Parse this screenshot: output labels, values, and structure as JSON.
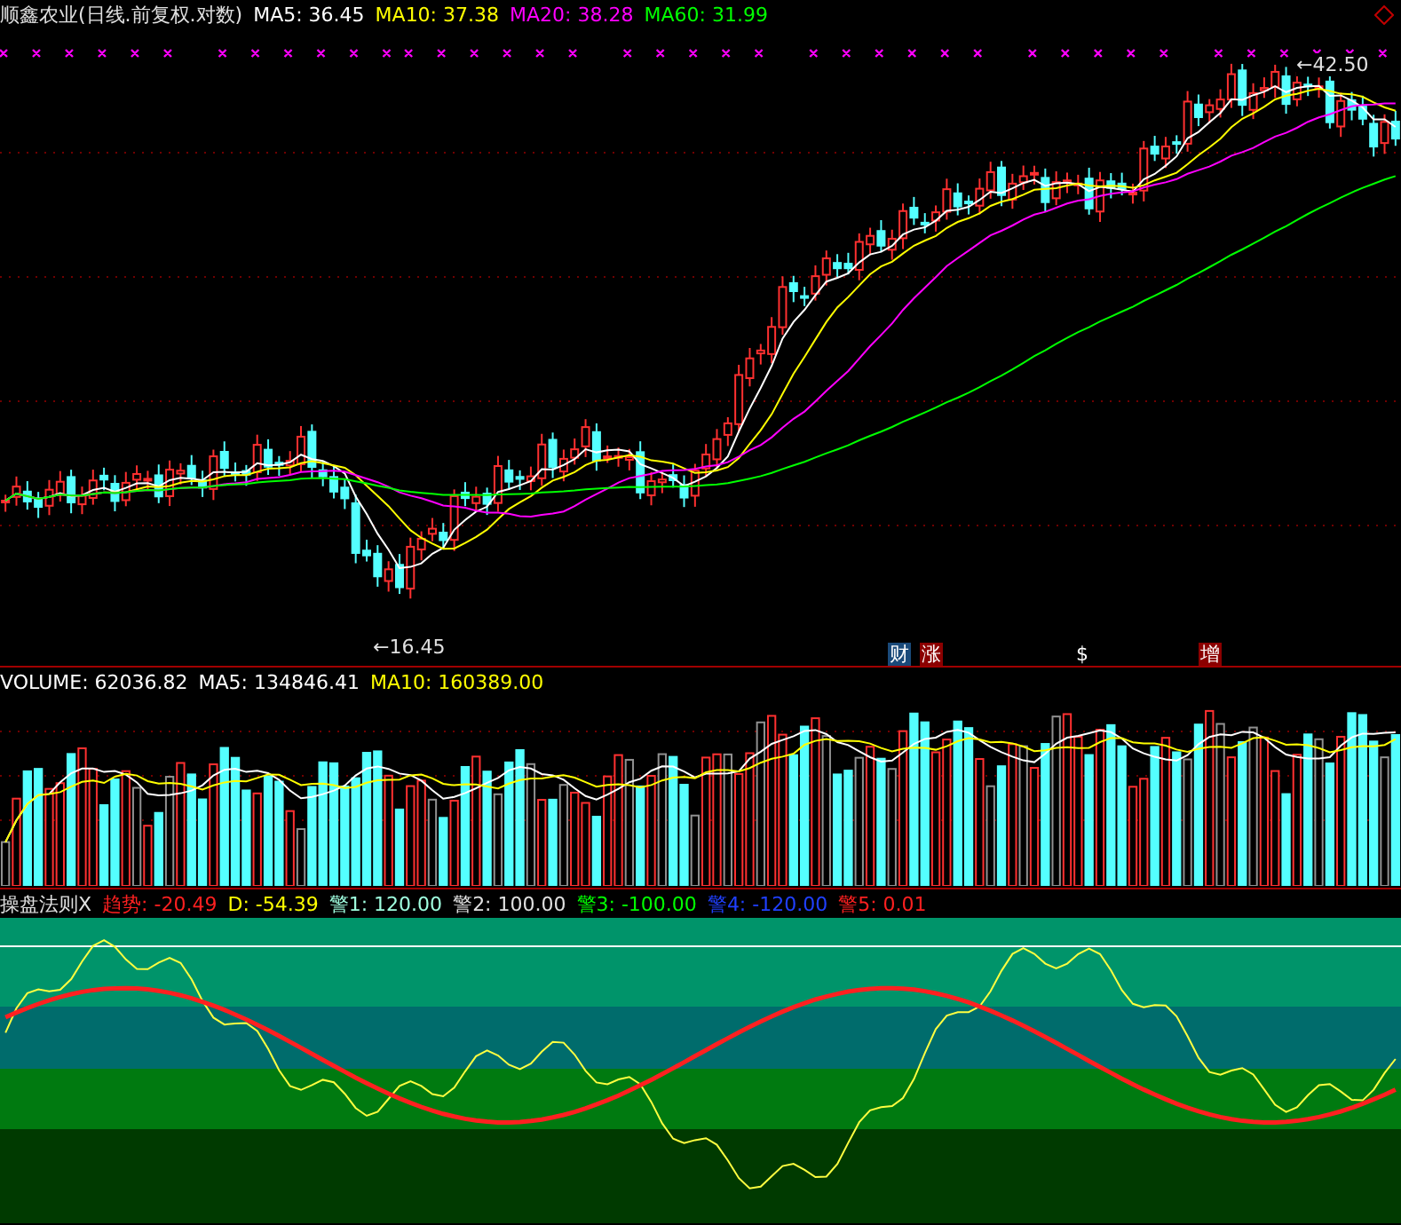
{
  "price_panel": {
    "title": "顺鑫农业(日线.前复权.对数)",
    "indicators": [
      {
        "label": "MA5: 36.45",
        "color": "#ffffff"
      },
      {
        "label": "MA10: 37.38",
        "color": "#ffff00"
      },
      {
        "label": "MA20: 38.28",
        "color": "#ff00ff"
      },
      {
        "label": "MA60: 31.99",
        "color": "#00ff00"
      }
    ],
    "high_marker": "←42.50",
    "low_marker": "←16.45",
    "event_tags": [
      {
        "text": "财",
        "color": "#1a4a7a"
      },
      {
        "text": "涨",
        "color": "#8b0000"
      },
      {
        "text": "$",
        "color": "#000000"
      },
      {
        "text": "增",
        "color": "#8b0000"
      }
    ]
  },
  "volume_panel": {
    "indicators": [
      {
        "label": "VOLUME: 62036.82",
        "color": "#ffffff"
      },
      {
        "label": "MA5: 134846.41",
        "color": "#ffffff"
      },
      {
        "label": "MA10: 160389.00",
        "color": "#ffff00"
      }
    ]
  },
  "indicator_panel": {
    "title": "操盘法则X",
    "indicators": [
      {
        "label": "趋势: -20.49",
        "color": "#ff2020"
      },
      {
        "label": "D: -54.39",
        "color": "#ffff00"
      },
      {
        "label": "警1: 120.00",
        "color": "#a0ffe0"
      },
      {
        "label": "警2: 100.00",
        "color": "#e0e0e0"
      },
      {
        "label": "警3: -100.00",
        "color": "#00ff00"
      },
      {
        "label": "警4: -120.00",
        "color": "#2040ff"
      },
      {
        "label": "警5: 0.01",
        "color": "#ff2020"
      }
    ]
  }
}
